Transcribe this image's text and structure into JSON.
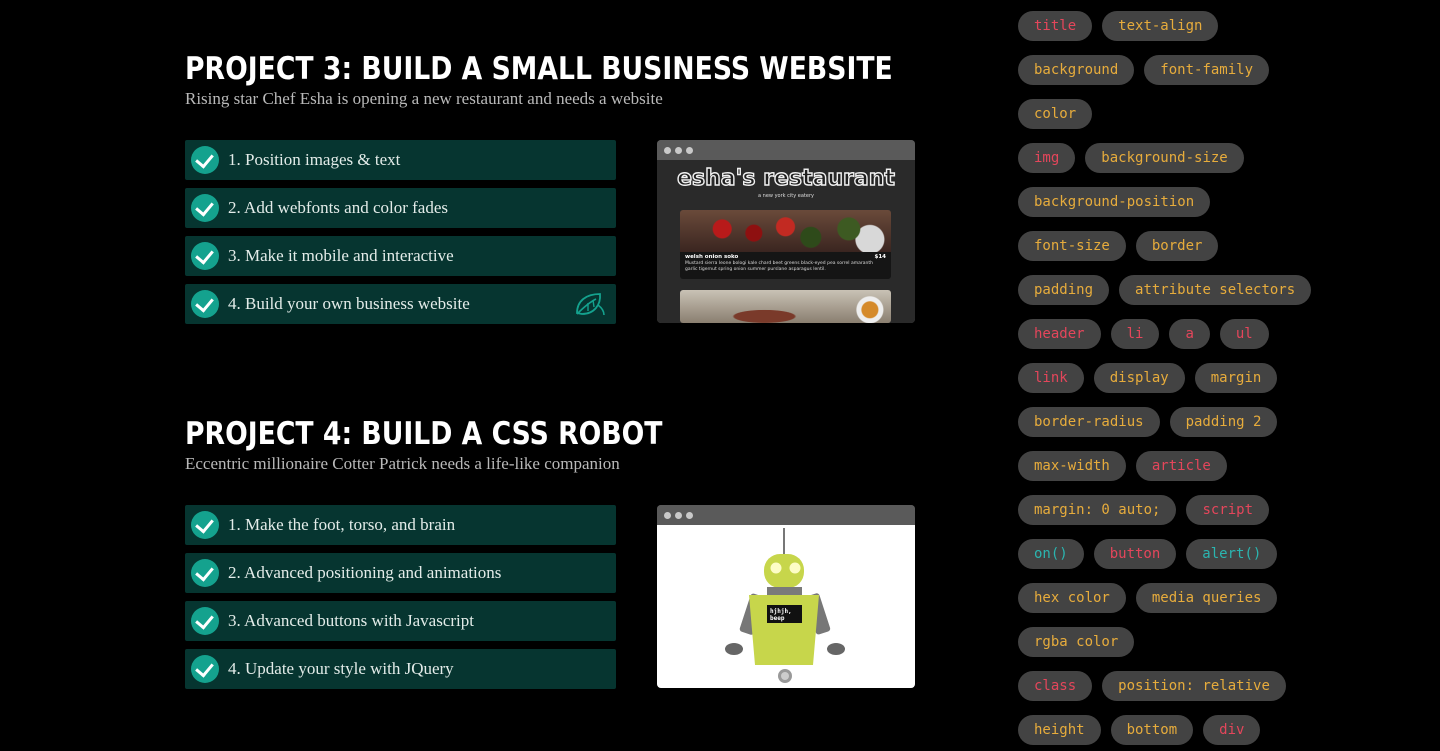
{
  "projects": [
    {
      "title": "PROJECT 3: BUILD A SMALL BUSINESS WEBSITE",
      "subtitle": "Rising star Chef Esha is opening a new restaurant and needs a website",
      "steps": [
        "1. Position images & text",
        "2. Add webfonts and color fades",
        "3. Make it mobile and interactive",
        "4. Build your own business website"
      ],
      "preview": {
        "site_title": "esha's restaurant",
        "tagline": "a new york city eatery",
        "dish_name": "welsh onion soko",
        "dish_price": "$14",
        "dish_desc": "Mustard sierra leone bologi kale chard beet greens black-eyed pea sorrel amaranth garlic tigernut spring onion summer purslane asparagus lentil."
      }
    },
    {
      "title": "PROJECT 4: BUILD A CSS ROBOT",
      "subtitle": "Eccentric millionaire Cotter Patrick needs a life-like companion",
      "steps": [
        "1. Make the foot, torso, and brain",
        "2. Advanced positioning and animations",
        "3. Advanced buttons with Javascript",
        "4. Update your style with JQuery"
      ],
      "preview": {
        "screen_text_1": "hjhjh,",
        "screen_text_2": "beep"
      }
    }
  ],
  "tag_colors": {
    "html": "#e4465b",
    "css": "#e7ac3c",
    "js": "#2bb5b0"
  },
  "tags": [
    [
      {
        "label": "title",
        "kind": "html"
      },
      {
        "label": "text-align",
        "kind": "css"
      }
    ],
    [
      {
        "label": "background",
        "kind": "css"
      },
      {
        "label": "font-family",
        "kind": "css"
      }
    ],
    [
      {
        "label": "color",
        "kind": "css"
      }
    ],
    [
      {
        "label": "img",
        "kind": "html"
      },
      {
        "label": "background-size",
        "kind": "css"
      }
    ],
    [
      {
        "label": "background-position",
        "kind": "css"
      }
    ],
    [
      {
        "label": "font-size",
        "kind": "css"
      },
      {
        "label": "border",
        "kind": "css"
      }
    ],
    [
      {
        "label": "padding",
        "kind": "css"
      },
      {
        "label": "attribute selectors",
        "kind": "css"
      }
    ],
    [
      {
        "label": "header",
        "kind": "html"
      },
      {
        "label": "li",
        "kind": "html"
      },
      {
        "label": "a",
        "kind": "html"
      },
      {
        "label": "ul",
        "kind": "html"
      }
    ],
    [
      {
        "label": "link",
        "kind": "html"
      },
      {
        "label": "display",
        "kind": "css"
      },
      {
        "label": "margin",
        "kind": "css"
      }
    ],
    [
      {
        "label": "border-radius",
        "kind": "css"
      },
      {
        "label": "padding 2",
        "kind": "css"
      }
    ],
    [
      {
        "label": "max-width",
        "kind": "css"
      },
      {
        "label": "article",
        "kind": "html"
      }
    ],
    [
      {
        "label": "margin: 0 auto;",
        "kind": "css"
      },
      {
        "label": "script",
        "kind": "html"
      }
    ],
    [
      {
        "label": "on()",
        "kind": "js"
      },
      {
        "label": "button",
        "kind": "html"
      },
      {
        "label": "alert()",
        "kind": "js"
      }
    ],
    [
      {
        "label": "hex color",
        "kind": "css"
      },
      {
        "label": "media queries",
        "kind": "css"
      }
    ],
    [
      {
        "label": "rgba color",
        "kind": "css"
      }
    ],
    [
      {
        "label": "class",
        "kind": "html"
      },
      {
        "label": "position: relative",
        "kind": "css"
      }
    ],
    [
      {
        "label": "height",
        "kind": "css"
      },
      {
        "label": "bottom",
        "kind": "css"
      },
      {
        "label": "div",
        "kind": "html"
      }
    ]
  ]
}
